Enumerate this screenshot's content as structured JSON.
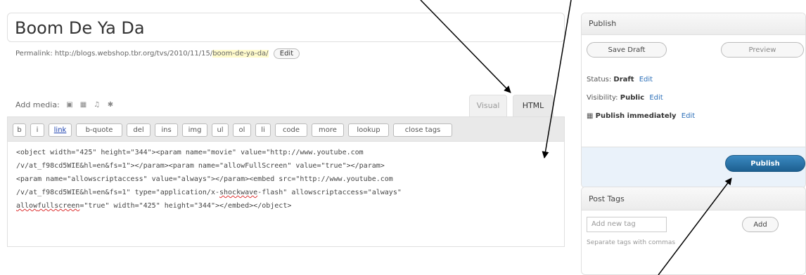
{
  "post": {
    "title": "Boom De Ya Da",
    "permalink_prefix": "Permalink: http://blogs.webshop.tbr.org/tvs/2010/11/15/",
    "permalink_slug": "boom-de-ya-da/",
    "permalink_edit": "Edit"
  },
  "media": {
    "label": "Add media:",
    "icons": [
      "image-icon",
      "video-icon",
      "audio-icon",
      "media-icon"
    ]
  },
  "tabs": {
    "visual": "Visual",
    "html": "HTML"
  },
  "quicktags": [
    "b",
    "i",
    "link",
    "b-quote",
    "del",
    "ins",
    "img",
    "ul",
    "ol",
    "li",
    "code",
    "more",
    "lookup",
    "close tags"
  ],
  "editor": {
    "line1": "<object width=\"425\" height=\"344\"><param name=\"movie\" value=\"http://www.youtube.com",
    "line2": "/v/at_f98cd5WIE&hl=en&fs=1\"></param><param name=\"allowFullScreen\" value=\"true\"></param>",
    "line3": "<param name=\"allowscriptaccess\" value=\"always\"></param><embed src=\"http://www.youtube.com",
    "line4a": "/v/at_f98cd5WIE&hl=en&fs=1\" type=\"application/x-",
    "line4b": "shockwave",
    "line4c": "-flash\" allowscriptaccess=\"always\"",
    "line5a": "allow",
    "line5b": "fullscreen",
    "line5c": "=\"true\" width=\"425\" height=\"344\"></embed></object>"
  },
  "publish": {
    "header": "Publish",
    "save_draft": "Save Draft",
    "preview": "Preview",
    "status_label": "Status:",
    "status_value": "Draft",
    "status_edit": "Edit",
    "visibility_label": "Visibility:",
    "visibility_value": "Public",
    "visibility_edit": "Edit",
    "schedule_text": "Publish immediately",
    "schedule_edit": "Edit",
    "publish_button": "Publish"
  },
  "tags": {
    "header": "Post Tags",
    "input_placeholder": "Add new tag",
    "add_button": "Add",
    "hint": "Separate tags with commas"
  },
  "colors": {
    "accent": "#21759b",
    "link": "#2c6fb8",
    "squiggle": "#dd3333"
  }
}
